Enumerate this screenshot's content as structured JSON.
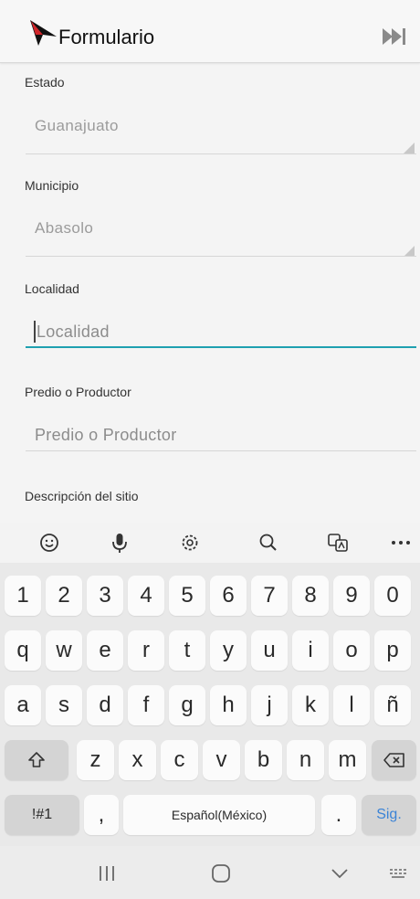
{
  "app_bar": {
    "title": "Formulario",
    "logo_icon": "red-black-bird-logo",
    "skip_icon": "skip-to-end-icon"
  },
  "form": {
    "estado": {
      "label": "Estado",
      "value": "Guanajuato"
    },
    "municipio": {
      "label": "Municipio",
      "value": "Abasolo"
    },
    "localidad": {
      "label": "Localidad",
      "placeholder": "Localidad"
    },
    "predio": {
      "label": "Predio o Productor",
      "placeholder": "Predio o Productor"
    },
    "descripcion": {
      "label": "Descripción del sitio"
    }
  },
  "keyboard_toolbar": {
    "icons": [
      "emoji-icon",
      "microphone-icon",
      "settings-icon",
      "search-icon",
      "translate-icon",
      "more-icon"
    ]
  },
  "keyboard": {
    "row_numbers": [
      "1",
      "2",
      "3",
      "4",
      "5",
      "6",
      "7",
      "8",
      "9",
      "0"
    ],
    "row_1": [
      "q",
      "w",
      "e",
      "r",
      "t",
      "y",
      "u",
      "i",
      "o",
      "p"
    ],
    "row_2": [
      "a",
      "s",
      "d",
      "f",
      "g",
      "h",
      "j",
      "k",
      "l",
      "ñ"
    ],
    "row_3": [
      "z",
      "x",
      "c",
      "v",
      "b",
      "n",
      "m"
    ],
    "symbols_label": "!#1",
    "comma_label": ",",
    "space_label": "Español(México)",
    "period_label": ".",
    "next_label": "Sig.",
    "accent_color": "#3b83d6"
  },
  "colors": {
    "focus_underline": "#1ea0b0"
  },
  "nav_bar": {
    "icons": [
      "recent-apps-icon",
      "home-icon",
      "back-icon",
      "keyboard-toggle-icon"
    ]
  }
}
